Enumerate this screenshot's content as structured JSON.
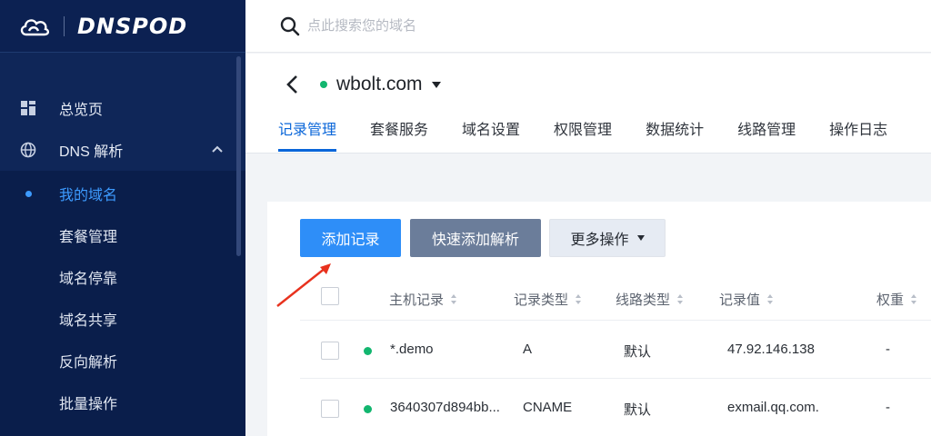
{
  "brand": {
    "logo_text": "DNSPOD"
  },
  "search": {
    "placeholder": "点此搜索您的域名"
  },
  "sidebar": {
    "items": [
      {
        "label": "总览页",
        "icon": "dashboard-icon"
      },
      {
        "label": "DNS 解析",
        "icon": "globe-icon",
        "expanded": true
      }
    ],
    "sub_items": [
      {
        "label": "我的域名",
        "active": true
      },
      {
        "label": "套餐管理"
      },
      {
        "label": "域名停靠"
      },
      {
        "label": "域名共享"
      },
      {
        "label": "反向解析"
      },
      {
        "label": "批量操作"
      }
    ]
  },
  "header": {
    "domain": "wbolt.com",
    "tabs": [
      {
        "label": "记录管理",
        "active": true
      },
      {
        "label": "套餐服务"
      },
      {
        "label": "域名设置"
      },
      {
        "label": "权限管理"
      },
      {
        "label": "数据统计"
      },
      {
        "label": "线路管理"
      },
      {
        "label": "操作日志"
      }
    ]
  },
  "toolbar": {
    "add_label": "添加记录",
    "quick_label": "快速添加解析",
    "more_label": "更多操作"
  },
  "table": {
    "columns": [
      "主机记录",
      "记录类型",
      "线路类型",
      "记录值",
      "权重"
    ],
    "rows": [
      {
        "host": "*.demo",
        "type": "A",
        "line": "默认",
        "value": "47.92.146.138",
        "weight": "-"
      },
      {
        "host": "3640307d894bb...",
        "type": "CNAME",
        "line": "默认",
        "value": "exmail.qq.com.",
        "weight": "-"
      }
    ]
  },
  "colors": {
    "sidebar_bg": "#0f2658",
    "accent": "#2e8ef8",
    "active_tab": "#0a66d9",
    "status_green": "#12b66f",
    "annotation_arrow": "#e8321e"
  }
}
